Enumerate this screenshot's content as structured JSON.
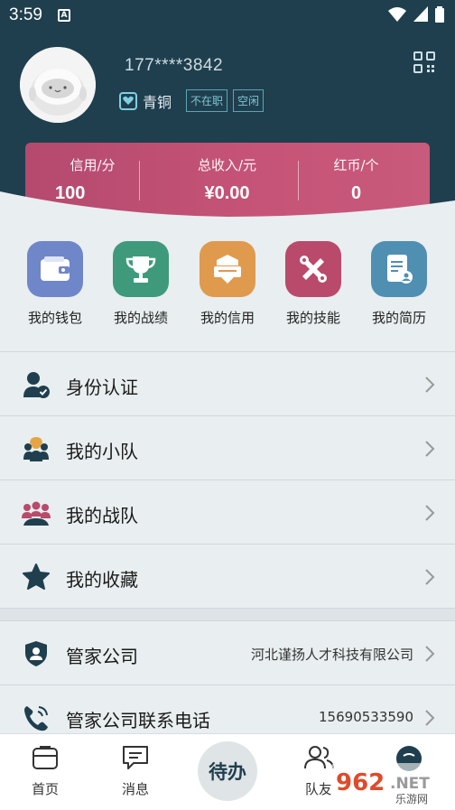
{
  "status_bar": {
    "time": "3:59",
    "notification_letter": "A"
  },
  "profile": {
    "phone": "177****3842",
    "level": "青铜",
    "tags": [
      "不在职",
      "空闲"
    ]
  },
  "stats": [
    {
      "label": "信用/分",
      "value": "100"
    },
    {
      "label": "总收入/元",
      "value": "¥0.00"
    },
    {
      "label": "红币/个",
      "value": "0"
    }
  ],
  "quick_menu": [
    {
      "label": "我的钱包",
      "icon": "wallet-icon",
      "color": "#6f86c9"
    },
    {
      "label": "我的战绩",
      "icon": "trophy-icon",
      "color": "#3f9a7c"
    },
    {
      "label": "我的信用",
      "icon": "credit-icon",
      "color": "#df9a4e"
    },
    {
      "label": "我的技能",
      "icon": "tools-icon",
      "color": "#b94a6c"
    },
    {
      "label": "我的简历",
      "icon": "resume-icon",
      "color": "#4f8fb2"
    }
  ],
  "list": [
    {
      "label": "身份认证",
      "icon": "user-verified-icon"
    },
    {
      "label": "我的小队",
      "icon": "squad-icon"
    },
    {
      "label": "我的战队",
      "icon": "team-icon"
    },
    {
      "label": "我的收藏",
      "icon": "star-icon"
    }
  ],
  "company": [
    {
      "label": "管家公司",
      "value": "河北谨扬人才科技有限公司",
      "icon": "shield-user-icon"
    },
    {
      "label": "管家公司联系电话",
      "value": "15690533590",
      "icon": "phone-icon"
    }
  ],
  "bottom_nav": {
    "home": "首页",
    "messages": "消息",
    "center": "待办",
    "teammates": "队友"
  },
  "watermark": {
    "brand": "962",
    "suffix": ".NET",
    "subtitle": "乐游网"
  },
  "colors": {
    "header": "#1f3f4e",
    "card": "#c65478",
    "background": "#e9eef0"
  }
}
